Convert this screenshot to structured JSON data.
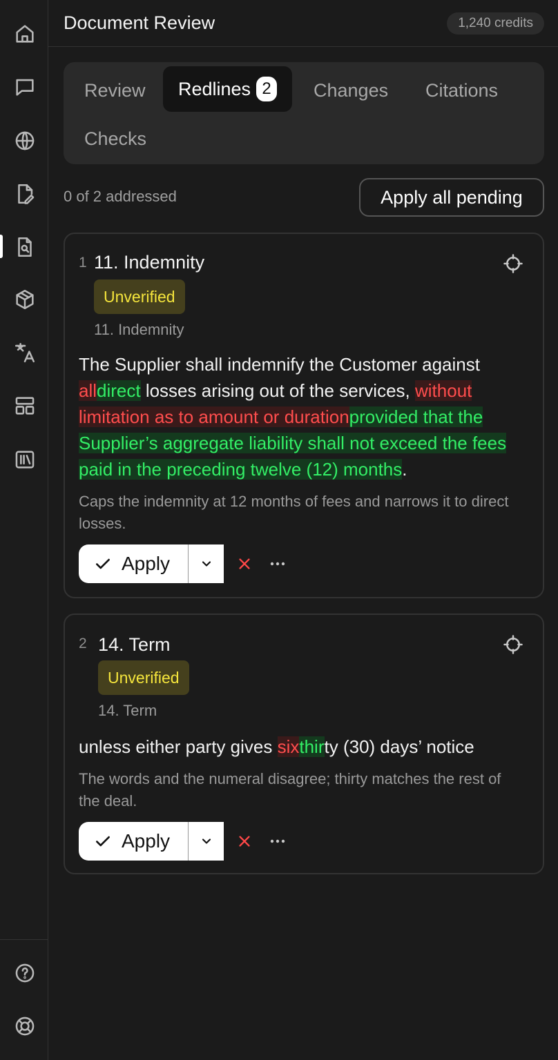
{
  "header": {
    "title": "Document Review",
    "credits": "1,240 credits"
  },
  "sidebar": {
    "items": [
      {
        "icon": "home-icon"
      },
      {
        "icon": "chat-icon"
      },
      {
        "icon": "globe-icon"
      },
      {
        "icon": "document-edit-icon"
      },
      {
        "icon": "document-search-icon",
        "active": true
      },
      {
        "icon": "cube-icon"
      },
      {
        "icon": "translate-icon"
      },
      {
        "icon": "layout-icon"
      },
      {
        "icon": "library-icon"
      }
    ],
    "bottom": [
      {
        "icon": "help-icon"
      },
      {
        "icon": "support-icon"
      }
    ]
  },
  "tabs": [
    {
      "label": "Review"
    },
    {
      "label": "Redlines",
      "badge": "2",
      "active": true
    },
    {
      "label": "Changes"
    },
    {
      "label": "Citations"
    },
    {
      "label": "Checks"
    }
  ],
  "progress_text": "0 of 2 addressed",
  "apply_all_label": "Apply all pending",
  "cards": [
    {
      "index": "1",
      "title": "11. Indemnity",
      "status": "Unverified",
      "subtitle": "11. Indemnity",
      "text": {
        "t1": "The Supplier shall indemnify the Customer against ",
        "d1": "all",
        "i1": "direct",
        "t2": " losses arising out of the services, ",
        "d2": "without limitation as to amount or duration",
        "i2": "provided that the Supplier’s aggregate liability shall not exceed the fees paid in the preceding twelve (12) months",
        "t3": "."
      },
      "note": "Caps the indemnity at 12 months of fees and narrows it to direct losses.",
      "apply_label": "Apply"
    },
    {
      "index": "2",
      "title": "14. Term",
      "status": "Unverified",
      "subtitle": "14. Term",
      "text": {
        "t1": "unless either party gives ",
        "d1": "six",
        "i1": "thir",
        "t2": "ty (30) days’ notice"
      },
      "note": "The words and the numeral disagree; thirty matches the rest of the deal.",
      "apply_label": "Apply"
    }
  ],
  "colors": {
    "deletion": "#ff4d4d",
    "insertion": "#33ee66",
    "unverified": "#f5e53c"
  }
}
